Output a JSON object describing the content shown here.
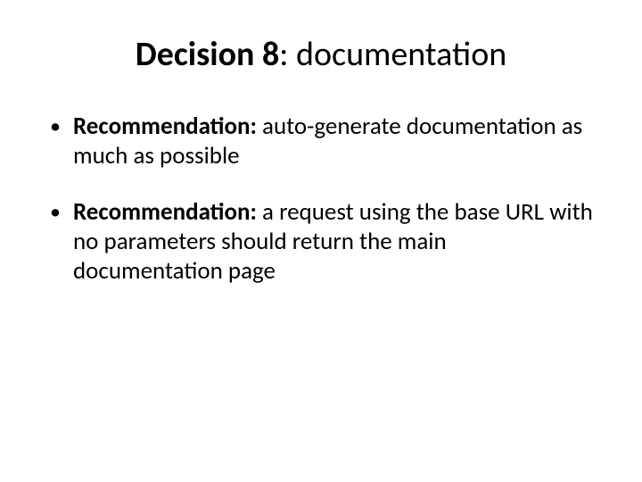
{
  "slide": {
    "title_bold": "Decision 8",
    "title_rest": ": documentation",
    "bullets": [
      {
        "label": "Recommendation:",
        "text": " auto-generate documentation as much as possible"
      },
      {
        "label": "Recommendation:",
        "text": " a request using the base URL with no parameters should return the main documentation page"
      }
    ]
  }
}
